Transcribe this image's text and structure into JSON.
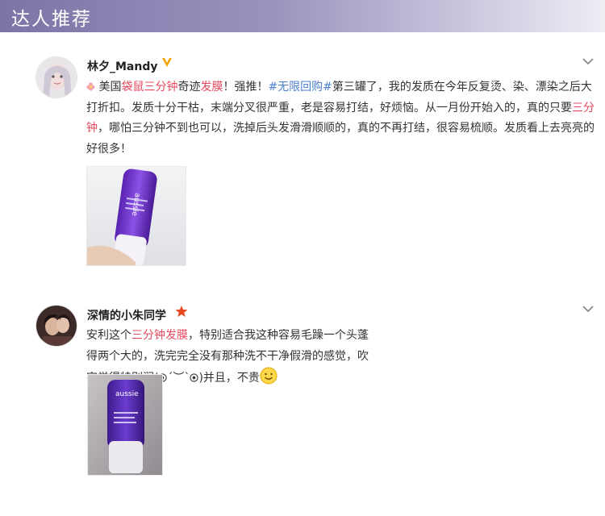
{
  "header": {
    "title": "达人推荐"
  },
  "posts": [
    {
      "username": "林夕_Mandy",
      "badge_icon": "gold-v-verified-icon",
      "segments": {
        "s1": "美国",
        "s2": "袋鼠三分钟",
        "s3": "奇迹",
        "s4": "发膜",
        "s5": "！强推！",
        "s6": "#无限回购#",
        "s7": "第三罐了，我的发质在今年反复烫、染、漂染之后大打折扣。发质十分干枯，末端分叉很严重，老是容易打结，好烦恼。从一月份开始入的，真的只要",
        "s8": "三分钟",
        "s9": "，哪怕三分钟不到也可以，洗掉后头发滑滑顺顺的，真的不再打结，很容易梳顺。发质看上去亮亮的好很多！"
      },
      "image_text": "aussie"
    },
    {
      "username": "深情的小朱同学",
      "badge_icon": "red-star-icon",
      "segments": {
        "s1": "安利这个",
        "s2": "三分钟发膜",
        "s3": "，特别适合我这种容易毛躁一个头蓬得两个大的，洗完完全没有那种洗不干净假滑的感觉，吹完觉得特别润(",
        "s4": "´︶`",
        "s5": ")并且，不贵"
      },
      "image_text": "aussie"
    }
  ],
  "colors": {
    "highlight": "#e8485e",
    "hashtag": "#4d7fd1",
    "header_purple": "#7d74a6"
  }
}
